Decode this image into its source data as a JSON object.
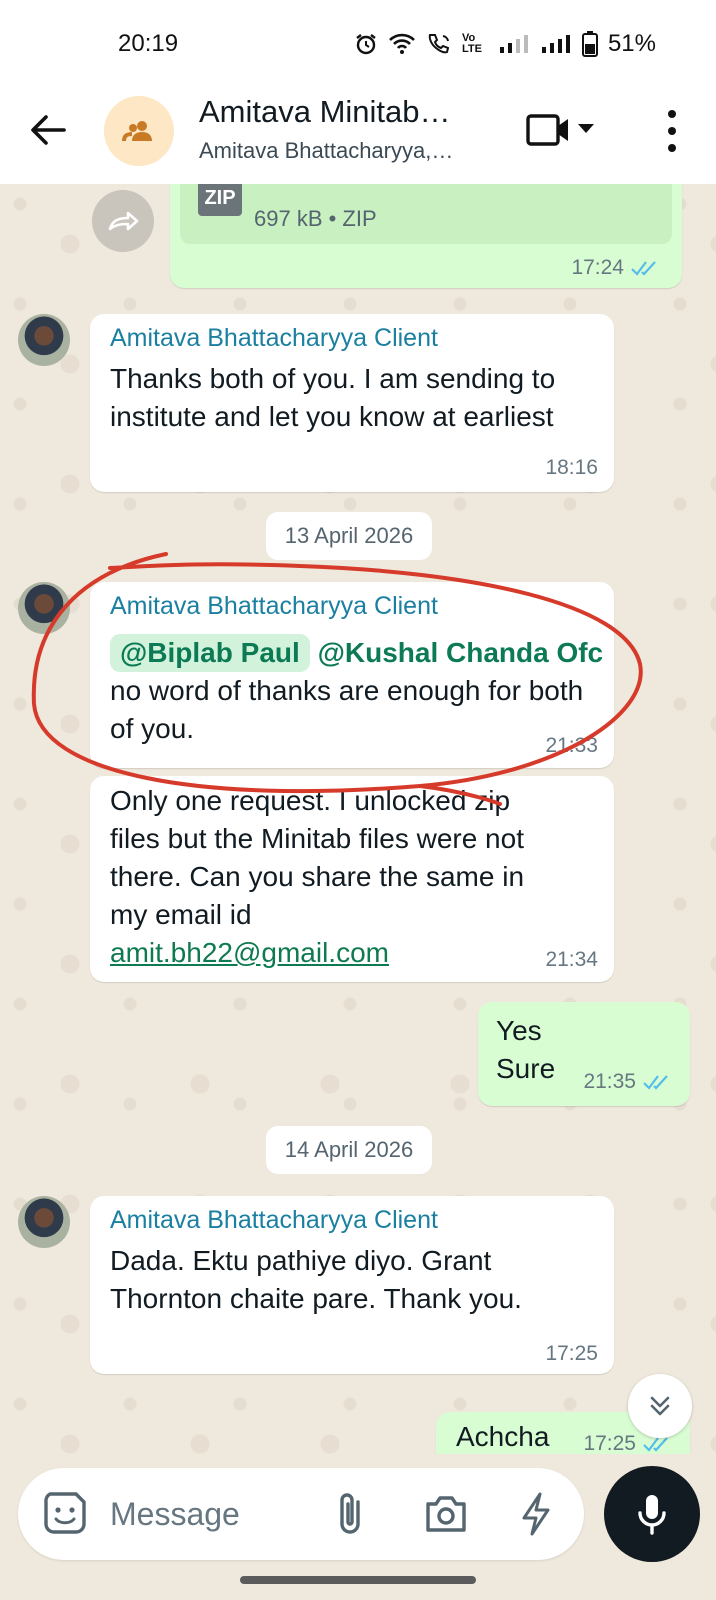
{
  "status_bar": {
    "time": "20:19",
    "battery": "51%",
    "volte_label": "Vo LTE"
  },
  "header": {
    "title": "Amitava Minitab…",
    "subtitle": "Amitava Bhattacharyya,…"
  },
  "messages": {
    "file": {
      "size_type": "697 kB • ZIP",
      "badge": "ZIP",
      "time": "17:24"
    },
    "m1": {
      "sender": "Amitava Bhattacharyya Client",
      "text": "Thanks both of you. I am sending to institute and let you know at earliest",
      "time": "18:16"
    },
    "date1": "13 April 2026",
    "m2": {
      "sender": "Amitava Bhattacharyya Client",
      "mention1": "@Biplab Paul",
      "mention2": "@Kushal Chanda",
      "mention2_cont": "Ofc",
      "text": " no word of thanks are enough for both of you.",
      "time": "21:33"
    },
    "m3": {
      "text": "Only one request. I unlocked zip files but the Minitab files were not there. Can you share the same in my email id",
      "email": "amit.bh22@gmail.com",
      "time": "21:34"
    },
    "m4": {
      "text_line1": "Yes",
      "text_line2": "Sure",
      "time": "21:35"
    },
    "date2": "14 April 2026",
    "m5": {
      "sender": "Amitava Bhattacharyya Client",
      "text": "Dada. Ektu pathiye diyo. Grant Thornton chaite pare. Thank you.",
      "time": "17:25"
    },
    "m6": {
      "text": "Achcha",
      "time": "17:25"
    }
  },
  "composer": {
    "placeholder": "Message"
  },
  "colors": {
    "accent": "#111b21",
    "outgoing_bubble": "#d9fdd3",
    "sender_name": "#1a7fa0",
    "read_ticks": "#53bdeb",
    "annotation": "#d63a2a"
  },
  "icons": [
    "back-arrow-icon",
    "group-icon",
    "video-call-icon",
    "dropdown-icon",
    "more-vert-icon",
    "forward-icon",
    "read-ticks-icon",
    "scroll-down-icon",
    "sticker-icon",
    "attach-icon",
    "camera-icon",
    "bolt-icon",
    "mic-icon"
  ]
}
